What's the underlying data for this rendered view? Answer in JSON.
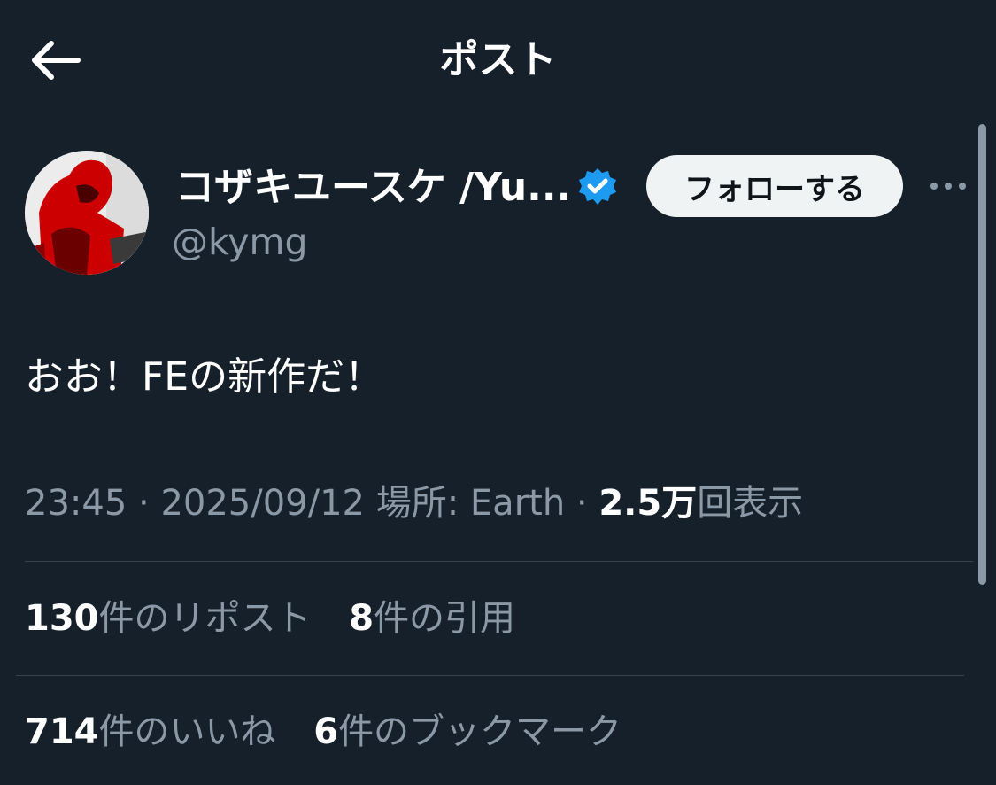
{
  "header": {
    "title": "ポスト",
    "back_icon": "arrow-left-icon"
  },
  "author": {
    "display_name": "コザキユースケ /Yu...",
    "handle": "@kymg",
    "verified": true,
    "verified_color": "#1d9bf0",
    "follow_label": "フォローする",
    "more_icon": "more-horizontal-icon"
  },
  "post": {
    "text": "おお！FEの新作だ！",
    "time": "23:45",
    "date": "2025/09/12",
    "location_label": "場所:",
    "location": "Earth",
    "separator": "·",
    "views_count": "2.5万",
    "views_label": "回表示"
  },
  "stats": {
    "reposts_count": "130",
    "reposts_label": "件のリポスト",
    "quotes_count": "8",
    "quotes_label": "件の引用",
    "likes_count": "714",
    "likes_label": "件のいいね",
    "bookmarks_count": "6",
    "bookmarks_label": "件のブックマーク"
  },
  "colors": {
    "background": "#15202b",
    "text": "#ffffff",
    "secondary_text": "#8b98a5",
    "divider": "#38444d",
    "follow_button_bg": "#eff3f4"
  }
}
